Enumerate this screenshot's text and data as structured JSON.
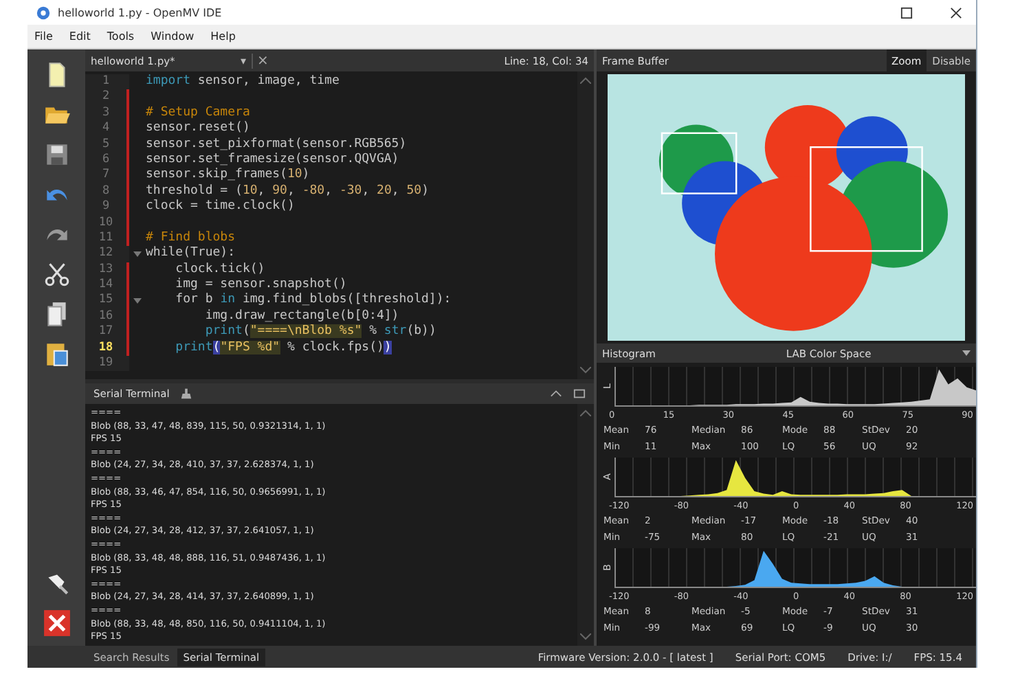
{
  "window": {
    "title": "helloworld 1.py - OpenMV IDE"
  },
  "menu": [
    "File",
    "Edit",
    "Tools",
    "Window",
    "Help"
  ],
  "toolbar": [
    {
      "kind": "new"
    },
    {
      "kind": "open"
    },
    {
      "kind": "save"
    },
    {
      "kind": "undo"
    },
    {
      "kind": "redo"
    },
    {
      "kind": "cut"
    },
    {
      "kind": "copy"
    },
    {
      "kind": "paste"
    }
  ],
  "device_buttons": [
    {
      "kind": "connect"
    },
    {
      "kind": "stop"
    }
  ],
  "editor": {
    "tab": "helloworld 1.py*",
    "tab_menu": "▾",
    "tab_close": "×",
    "position": "Line: 18, Col: 34",
    "lines": [
      {
        "number": "1",
        "modified": false,
        "fold": false,
        "current": false,
        "tokens": [
          {
            "text": "import",
            "kind": "kw"
          },
          {
            "text": " sensor, image, time",
            "kind": "plain"
          }
        ]
      },
      {
        "number": "2",
        "modified": true,
        "fold": false,
        "current": false
      },
      {
        "number": "3",
        "modified": true,
        "fold": false,
        "current": false,
        "tokens": [
          {
            "text": "# Setup Camera",
            "kind": "comment"
          }
        ]
      },
      {
        "number": "4",
        "modified": true,
        "fold": false,
        "current": false,
        "tokens": [
          {
            "text": "sensor.reset()",
            "kind": "plain"
          }
        ]
      },
      {
        "number": "5",
        "modified": true,
        "fold": false,
        "current": false,
        "tokens": [
          {
            "text": "sensor.set_pixformat(sensor.RGB565)",
            "kind": "plain"
          }
        ]
      },
      {
        "number": "6",
        "modified": true,
        "fold": false,
        "current": false,
        "tokens": [
          {
            "text": "sensor.set_framesize(sensor.QQVGA)",
            "kind": "plain"
          }
        ]
      },
      {
        "number": "7",
        "modified": true,
        "fold": false,
        "current": false,
        "tokens": [
          {
            "text": "sensor.skip_frames(",
            "kind": "plain"
          },
          {
            "text": "10",
            "kind": "num"
          },
          {
            "text": ")",
            "kind": "plain"
          }
        ]
      },
      {
        "number": "8",
        "modified": true,
        "fold": false,
        "current": false,
        "tokens": [
          {
            "text": "threshold = (",
            "kind": "plain"
          },
          {
            "text": "10",
            "kind": "num"
          },
          {
            "text": ", ",
            "kind": "plain"
          },
          {
            "text": "90",
            "kind": "num"
          },
          {
            "text": ", ",
            "kind": "plain"
          },
          {
            "text": "-80",
            "kind": "num"
          },
          {
            "text": ", ",
            "kind": "plain"
          },
          {
            "text": "-30",
            "kind": "num"
          },
          {
            "text": ", ",
            "kind": "plain"
          },
          {
            "text": "20",
            "kind": "num"
          },
          {
            "text": ", ",
            "kind": "plain"
          },
          {
            "text": "50",
            "kind": "num"
          },
          {
            "text": ")",
            "kind": "plain"
          }
        ]
      },
      {
        "number": "9",
        "modified": true,
        "fold": false,
        "current": false,
        "tokens": [
          {
            "text": "clock = time.clock()",
            "kind": "plain"
          }
        ]
      },
      {
        "number": "10",
        "modified": true,
        "fold": false,
        "current": false
      },
      {
        "number": "11",
        "modified": true,
        "fold": false,
        "current": false,
        "tokens": [
          {
            "text": "# Find blobs",
            "kind": "comment"
          }
        ]
      },
      {
        "number": "12",
        "modified": false,
        "fold": true,
        "current": false,
        "tokens": [
          {
            "text": "while(True):",
            "kind": "plain"
          }
        ]
      },
      {
        "number": "13",
        "modified": true,
        "fold": false,
        "current": false,
        "tokens": [
          {
            "text": "    clock.tick()",
            "kind": "plain"
          }
        ]
      },
      {
        "number": "14",
        "modified": true,
        "fold": false,
        "current": false,
        "tokens": [
          {
            "text": "    img = sensor.snapshot()",
            "kind": "plain"
          }
        ]
      },
      {
        "number": "15",
        "modified": true,
        "fold": true,
        "current": false,
        "tokens": [
          {
            "text": "    for b ",
            "kind": "plain"
          },
          {
            "text": "in",
            "kind": "kw"
          },
          {
            "text": " img.find_blobs([threshold]):",
            "kind": "plain"
          }
        ]
      },
      {
        "number": "16",
        "modified": true,
        "fold": false,
        "current": false,
        "tokens": [
          {
            "text": "        img.draw_rectangle(b[0:4])",
            "kind": "plain"
          }
        ]
      },
      {
        "number": "17",
        "modified": true,
        "fold": false,
        "current": false,
        "tokens": [
          {
            "text": "        print",
            "kind": "kw"
          },
          {
            "text": "(",
            "kind": "plain"
          },
          {
            "text": "\"====\\nBlob %s\"",
            "kind": "str"
          },
          {
            "text": " % ",
            "kind": "plain"
          },
          {
            "text": "str",
            "kind": "kw"
          },
          {
            "text": "(b))",
            "kind": "plain"
          }
        ]
      },
      {
        "number": "18",
        "modified": true,
        "fold": false,
        "current": true,
        "tokens": [
          {
            "text": "    print",
            "kind": "kw"
          },
          {
            "text": "(",
            "kind": "bracket"
          },
          {
            "text": "\"FPS %d\"",
            "kind": "str"
          },
          {
            "text": " % clock.fps()",
            "kind": "plain"
          },
          {
            "text": ")",
            "kind": "bracket"
          }
        ]
      },
      {
        "number": "19",
        "modified": false,
        "fold": false,
        "current": false
      }
    ]
  },
  "terminal": {
    "title": "Serial Terminal",
    "lines": [
      "====",
      "Blob (88, 33, 47, 48, 839, 115, 50, 0.9321314, 1, 1)",
      "FPS 15",
      "====",
      "Blob (24, 27, 34, 28, 410, 37, 37, 2.628374, 1, 1)",
      "====",
      "Blob (88, 33, 46, 47, 854, 116, 50, 0.9656991, 1, 1)",
      "FPS 15",
      "====",
      "Blob (24, 27, 34, 28, 412, 37, 37, 2.641057, 1, 1)",
      "====",
      "Blob (88, 33, 48, 48, 888, 116, 51, 0.9487436, 1, 1)",
      "FPS 15",
      "====",
      "Blob (24, 27, 34, 28, 414, 37, 37, 2.640899, 1, 1)",
      "====",
      "Blob (88, 33, 48, 48, 850, 116, 50, 0.9411104, 1, 1)",
      "FPS 15"
    ]
  },
  "frame_buffer": {
    "title": "Frame Buffer",
    "buttons": [
      {
        "label": "Zoom",
        "selected": true
      },
      {
        "label": "Disable",
        "selected": false
      }
    ]
  },
  "histogram": {
    "title": "Histogram",
    "color_space": "LAB Color Space",
    "channels": [
      {
        "name": "L",
        "color": "#c8c8c8",
        "ticks": [
          "0",
          "15",
          "30",
          "45",
          "60",
          "75",
          "90"
        ],
        "stats": [
          [
            "Mean",
            "76",
            "Median",
            "86",
            "Mode",
            "88",
            "StDev",
            "20"
          ],
          [
            "Min",
            "11",
            "Max",
            "100",
            "LQ",
            "56",
            "UQ",
            "92"
          ]
        ]
      },
      {
        "name": "A",
        "color": "#e6e640",
        "ticks": [
          "-120",
          "-80",
          "-40",
          "0",
          "40",
          "80",
          "120"
        ],
        "stats": [
          [
            "Mean",
            "2",
            "Median",
            "-17",
            "Mode",
            "-18",
            "StDev",
            "40"
          ],
          [
            "Min",
            "-75",
            "Max",
            "80",
            "LQ",
            "-21",
            "UQ",
            "31"
          ]
        ]
      },
      {
        "name": "B",
        "color": "#4aa8f0",
        "ticks": [
          "-120",
          "-80",
          "-40",
          "0",
          "40",
          "80",
          "120"
        ],
        "stats": [
          [
            "Mean",
            "8",
            "Median",
            "-5",
            "Mode",
            "-7",
            "StDev",
            "31"
          ],
          [
            "Min",
            "-99",
            "Max",
            "69",
            "LQ",
            "-9",
            "UQ",
            "30"
          ]
        ]
      }
    ]
  },
  "bottom_tabs": [
    {
      "label": "Search Results",
      "selected": false
    },
    {
      "label": "Serial Terminal",
      "selected": true
    }
  ],
  "status": [
    "Firmware Version: 2.0.0 - [ latest ]",
    "Serial Port: COM5",
    "Drive: I:/",
    "FPS: 15.4"
  ]
}
